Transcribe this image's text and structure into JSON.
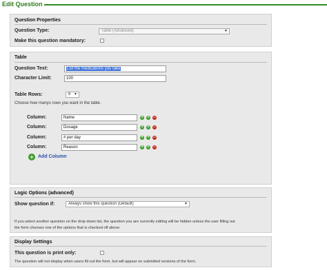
{
  "header": {
    "title": "Edit Question"
  },
  "properties": {
    "title": "Question Properties",
    "type_label": "Question Type:",
    "type_value": "Table (Advanced)",
    "mandatory_label": "Make this question mandatory:"
  },
  "table": {
    "title": "Table",
    "question_text_label": "Question Text:",
    "question_text_value": "List the medications you take",
    "char_limit_label": "Character Limit:",
    "char_limit_value": "100",
    "rows_label": "Table Rows:",
    "rows_value": "8",
    "rows_note": "Choose how manys rows you want in the table.",
    "column_label": "Column:",
    "columns": [
      "Name",
      "Dosage",
      "# per day",
      "Reason"
    ],
    "add_column_label": "Add Column"
  },
  "logic": {
    "title": "Logic Options (advanced)",
    "show_if_label": "Show question if:",
    "show_if_value": "Always show this question (Default)",
    "note_line1": "If you select another question on the drop down list, the question you are currently editing will be hidden unless the user filling out",
    "note_line2": "the form chooses one of the options that is checked off above."
  },
  "display": {
    "title": "Display Settings",
    "print_only_label": "This question is print only:",
    "note": "The question will not display when users fill out the form, but will appear on submitted versions of the form."
  },
  "icons": {
    "plus": "+",
    "minus": "−",
    "arrow": "▼"
  },
  "colors": {
    "accent_green": "#2e8b22",
    "link_blue": "#2a52a8",
    "remove_red": "#c8281e"
  }
}
